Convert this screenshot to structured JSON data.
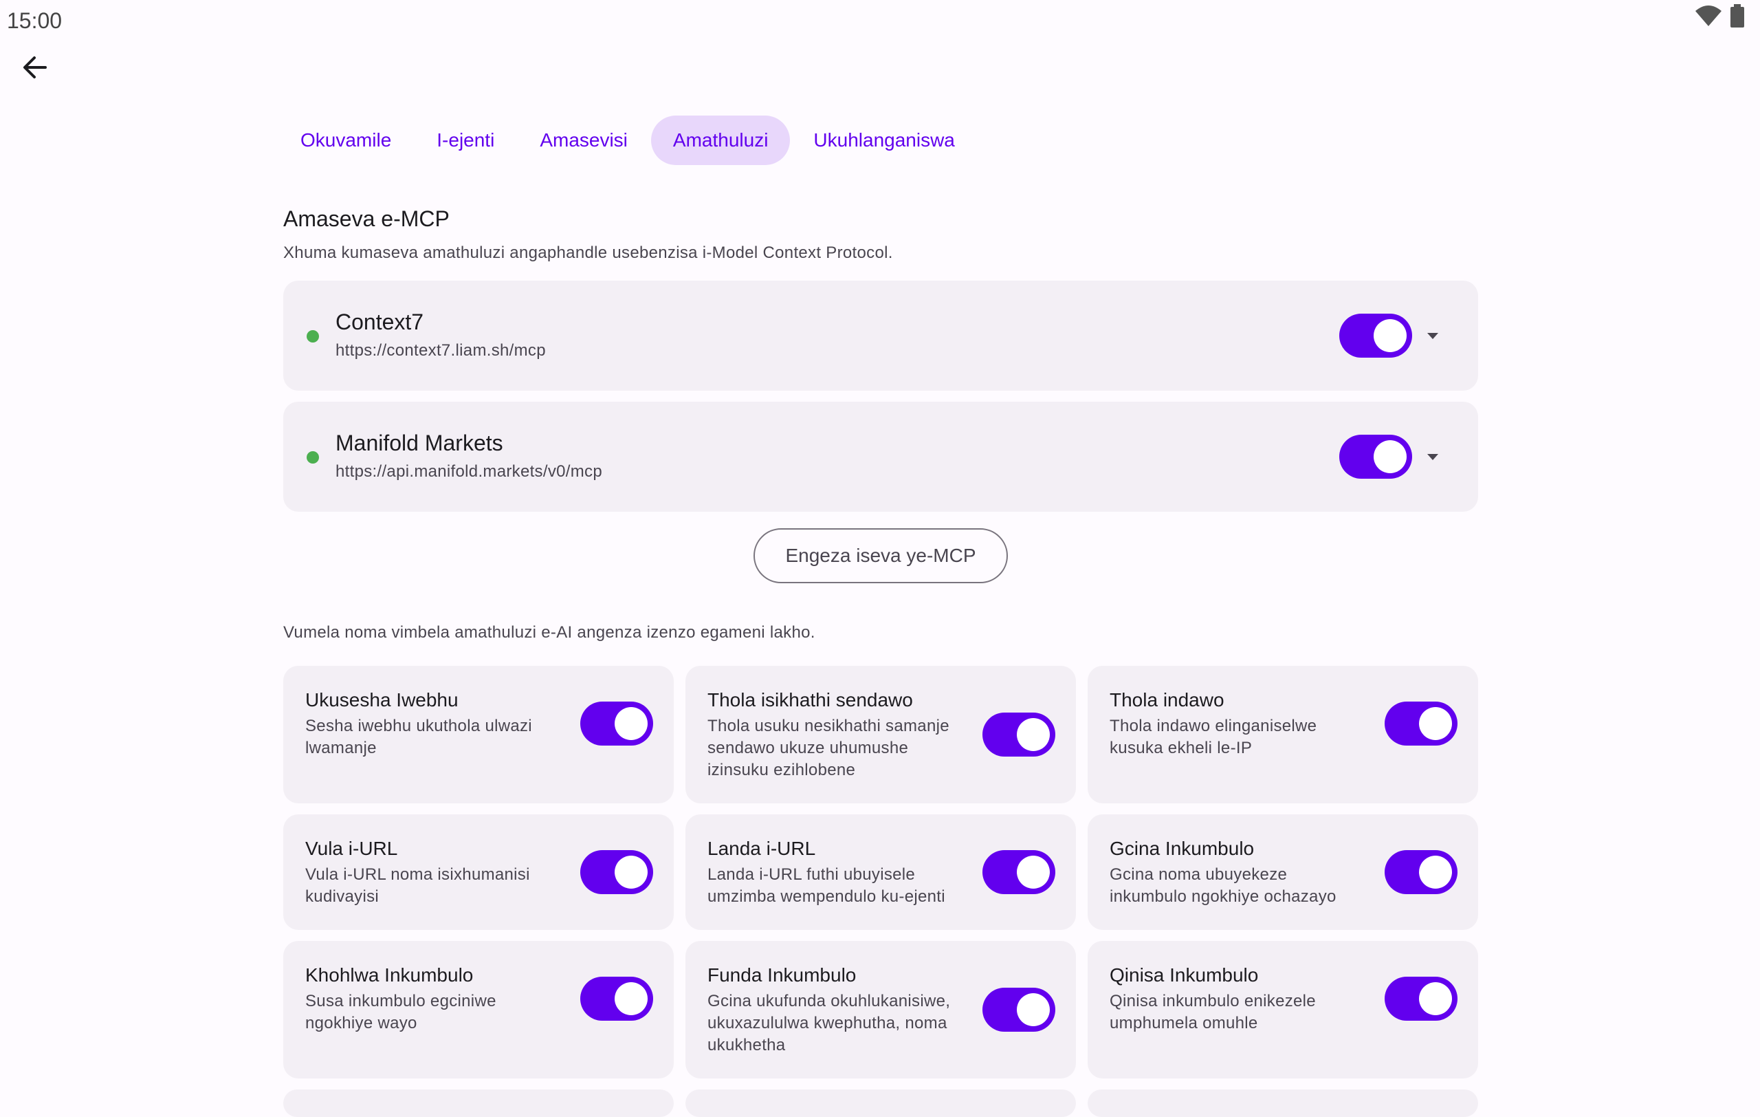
{
  "status": {
    "time": "15:00"
  },
  "tabs": [
    {
      "label": "Okuvamile",
      "active": false
    },
    {
      "label": "I-ejenti",
      "active": false
    },
    {
      "label": "Amasevisi",
      "active": false
    },
    {
      "label": "Amathuluzi",
      "active": true
    },
    {
      "label": "Ukuhlanganiswa",
      "active": false
    }
  ],
  "mcp": {
    "title": "Amaseva e-MCP",
    "description": "Xhuma kumaseva amathuluzi angaphandle usebenzisa i-Model Context Protocol.",
    "servers": [
      {
        "name": "Context7",
        "url": "https://context7.liam.sh/mcp",
        "enabled": true
      },
      {
        "name": "Manifold Markets",
        "url": "https://api.manifold.markets/v0/mcp",
        "enabled": true
      }
    ],
    "add_label": "Engeza iseva ye-MCP"
  },
  "tools": {
    "description": "Vumela noma vimbela amathuluzi e-AI angenza izenzo egameni lakho.",
    "items": [
      {
        "title": "Ukusesha Iwebhu",
        "desc": "Sesha iwebhu ukuthola ulwazi lwamanje",
        "enabled": true
      },
      {
        "title": "Thola isikhathi sendawo",
        "desc": "Thola usuku nesikhathi samanje sendawo ukuze uhumushe izinsuku ezihlobene",
        "enabled": true
      },
      {
        "title": "Thola indawo",
        "desc": "Thola indawo elinganiselwe kusuka ekheli le-IP",
        "enabled": true
      },
      {
        "title": "Vula i-URL",
        "desc": "Vula i-URL noma isixhumanisi kudivayisi",
        "enabled": true
      },
      {
        "title": "Landa i-URL",
        "desc": "Landa i-URL futhi ubuyisele umzimba wempendulo ku-ejenti",
        "enabled": true
      },
      {
        "title": "Gcina Inkumbulo",
        "desc": "Gcina noma ubuyekeze inkumbulo ngokhiye ochazayo",
        "enabled": true
      },
      {
        "title": "Khohlwa Inkumbulo",
        "desc": "Susa inkumbulo egciniwe ngokhiye wayo",
        "enabled": true
      },
      {
        "title": "Funda Inkumbulo",
        "desc": "Gcina ukufunda okuhlukanisiwe, ukuxazululwa kwephutha, noma ukukhetha",
        "enabled": true
      },
      {
        "title": "Qinisa Inkumbulo",
        "desc": "Qinisa inkumbulo enikezele umphumela omuhle",
        "enabled": true
      }
    ]
  },
  "colors": {
    "accent": "#6200ee",
    "active_tab": "#e8d7fb",
    "card": "#f3eff5",
    "status_dot": "#4caf50"
  }
}
